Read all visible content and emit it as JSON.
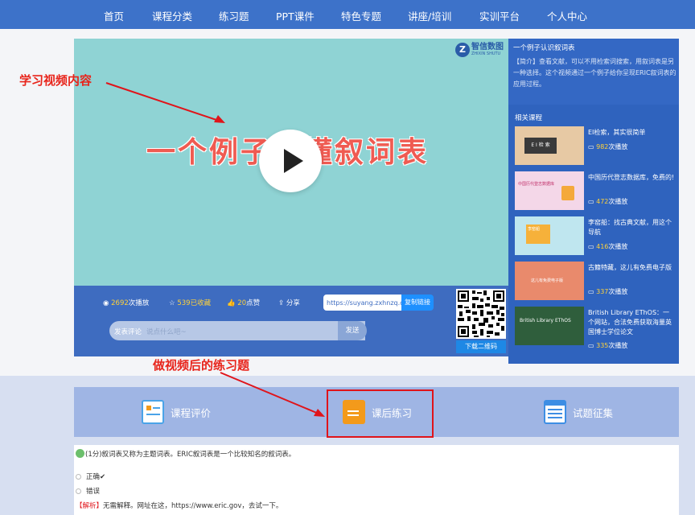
{
  "nav": {
    "items": [
      "首页",
      "课程分类",
      "练习题",
      "PPT课件",
      "特色专题",
      "讲座/培训",
      "实训平台",
      "个人中心"
    ]
  },
  "annotations": {
    "video_content": "学习视频内容",
    "exercise_after": "做视频后的练习题"
  },
  "video": {
    "title_overlay": "一个例子搞懂叙词表",
    "logo_text": "智信数图",
    "logo_sub": "ZHIXIN SHUTU",
    "stats": {
      "plays": "2692",
      "plays_suffix": "次播放",
      "favorites": "539",
      "favorites_suffix": "已收藏",
      "likes": "20",
      "likes_suffix": "点赞",
      "share": "分享"
    },
    "share_link": "https://suyang.zxhnzq.co",
    "copy_button": "复制链接",
    "comment_label": "发表评论",
    "comment_placeholder": "说点什么吧~",
    "send_button": "发送",
    "qr_download": "下载二维码"
  },
  "sidebar": {
    "title": "一个例子认识叙词表",
    "description": "【简介】查看文献，可以不用检索词搜索，用叙词表是另一种选择。这个视频通过一个例子给你呈现ERIC叙词表的应用过程。",
    "related_title": "相关课程",
    "related": [
      {
        "title": "EI检索，其实很简单",
        "plays": "982",
        "suffix": "次播放",
        "thumb_color": "#e7c9a4",
        "thumb_text": "E I 检 索"
      },
      {
        "title": "中国历代登志数据库，免费的!",
        "plays": "472",
        "suffix": "次播放",
        "thumb_color": "#f4d7e8",
        "thumb_text": "中国历代登志数据库"
      },
      {
        "title": "李窑船：找古典文献，用这个导航",
        "plays": "416",
        "suffix": "次播放",
        "thumb_color": "#bfe6ef",
        "thumb_text": "李窑船"
      },
      {
        "title": "古籍特藏，这儿有免费电子版",
        "plays": "337",
        "suffix": "次播放",
        "thumb_color": "#e98a6c",
        "thumb_text": "这儿有免费电子版"
      },
      {
        "title": "British Library EThOS：一个网站，合法免费获取海量英国博士学位论文",
        "plays": "335",
        "suffix": "次播放",
        "thumb_color": "#2f5e3c",
        "thumb_text": "British Library EThOS"
      }
    ]
  },
  "tabs": [
    {
      "label": "课程评价",
      "icon_color": "#4aa3e8"
    },
    {
      "label": "课后练习",
      "icon_color": "#f39a1b"
    },
    {
      "label": "试题征集",
      "icon_color": "#3d8ee4"
    }
  ],
  "question": {
    "text": "(1分)叙词表又称为主题词表。ERIC叙词表是一个比较知名的叙词表。",
    "options": [
      "正确✔",
      "错误"
    ],
    "explanation_tag": "【解析】",
    "explanation": "无需解释。网址在这，https://www.eric.gov，去试一下。"
  }
}
